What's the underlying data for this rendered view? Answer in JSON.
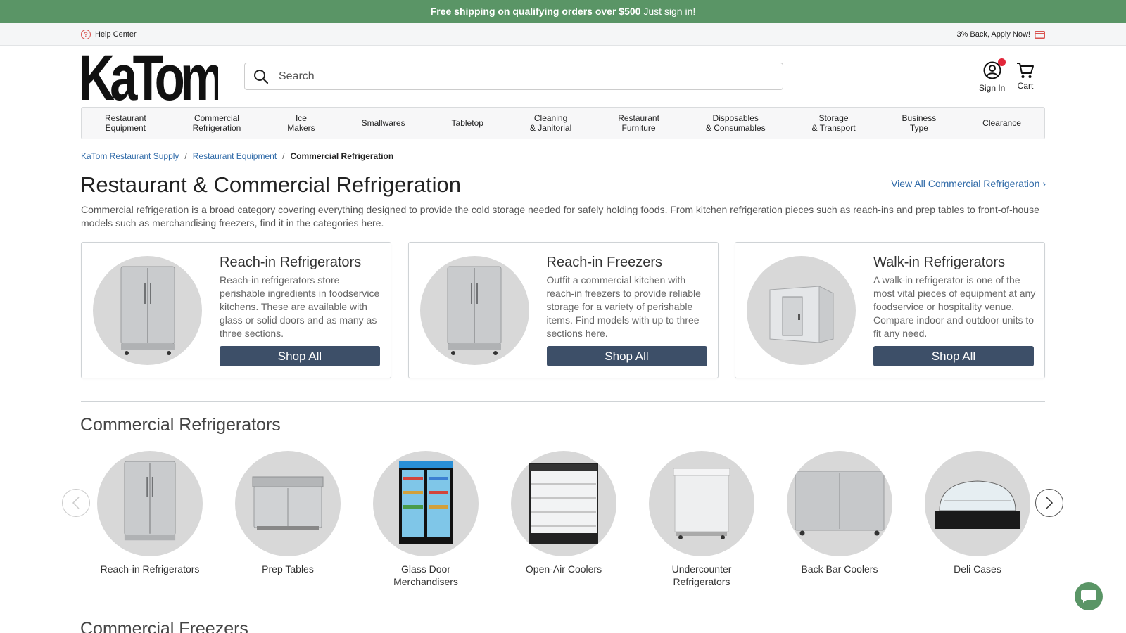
{
  "promo": {
    "bold_text": "Free shipping on qualifying orders over $500",
    "text": "Just sign in!"
  },
  "utility": {
    "help_label": "Help Center",
    "cashback_label": "3% Back, Apply Now!"
  },
  "header": {
    "logo_text": "KaTom",
    "search_placeholder": "Search",
    "signin_label": "Sign In",
    "cart_label": "Cart"
  },
  "nav": [
    "Restaurant\nEquipment",
    "Commercial\nRefrigeration",
    "Ice\nMakers",
    "Smallwares",
    "Tabletop",
    "Cleaning\n& Janitorial",
    "Restaurant\nFurniture",
    "Disposables\n& Consumables",
    "Storage\n& Transport",
    "Business\nType",
    "Clearance"
  ],
  "breadcrumb": {
    "home": "KaTom Restaurant Supply",
    "parent": "Restaurant Equipment",
    "current": "Commercial Refrigeration",
    "sep": "/"
  },
  "page": {
    "title": "Restaurant & Commercial Refrigeration",
    "view_all": "View All Commercial Refrigeration",
    "intro": "Commercial refrigeration is a broad category covering everything designed to provide the cold storage needed for safely holding foods. From kitchen refrigeration pieces such as reach-ins and prep tables to front-of-house models such as merchandising freezers, find it in the categories here."
  },
  "cards": [
    {
      "title": "Reach-in Refrigerators",
      "desc": "Reach-in refrigerators store perishable ingredients in foodservice kitchens. These are available with glass or solid doors and as many as three sections.",
      "button": "Shop All"
    },
    {
      "title": "Reach-in Freezers",
      "desc": "Outfit a commercial kitchen with reach-in freezers to provide reliable storage for a variety of perishable items. Find models with up to three sections here.",
      "button": "Shop All"
    },
    {
      "title": "Walk-in Refrigerators",
      "desc": "A walk-in refrigerator is one of the most vital pieces of equipment at any foodservice or hospitality venue. Compare indoor and outdoor units to fit any need.",
      "button": "Shop All"
    }
  ],
  "section1": {
    "title": "Commercial Refrigerators",
    "items": [
      "Reach-in Refrigerators",
      "Prep Tables",
      "Glass Door\nMerchandisers",
      "Open-Air Coolers",
      "Undercounter\nRefrigerators",
      "Back Bar Coolers",
      "Deli Cases"
    ]
  },
  "section2": {
    "title": "Commercial Freezers"
  },
  "colors": {
    "promo_green": "#5a9566",
    "button_navy": "#3d4f68",
    "link_blue": "#2f6aa8",
    "badge_red": "#e2263a"
  }
}
